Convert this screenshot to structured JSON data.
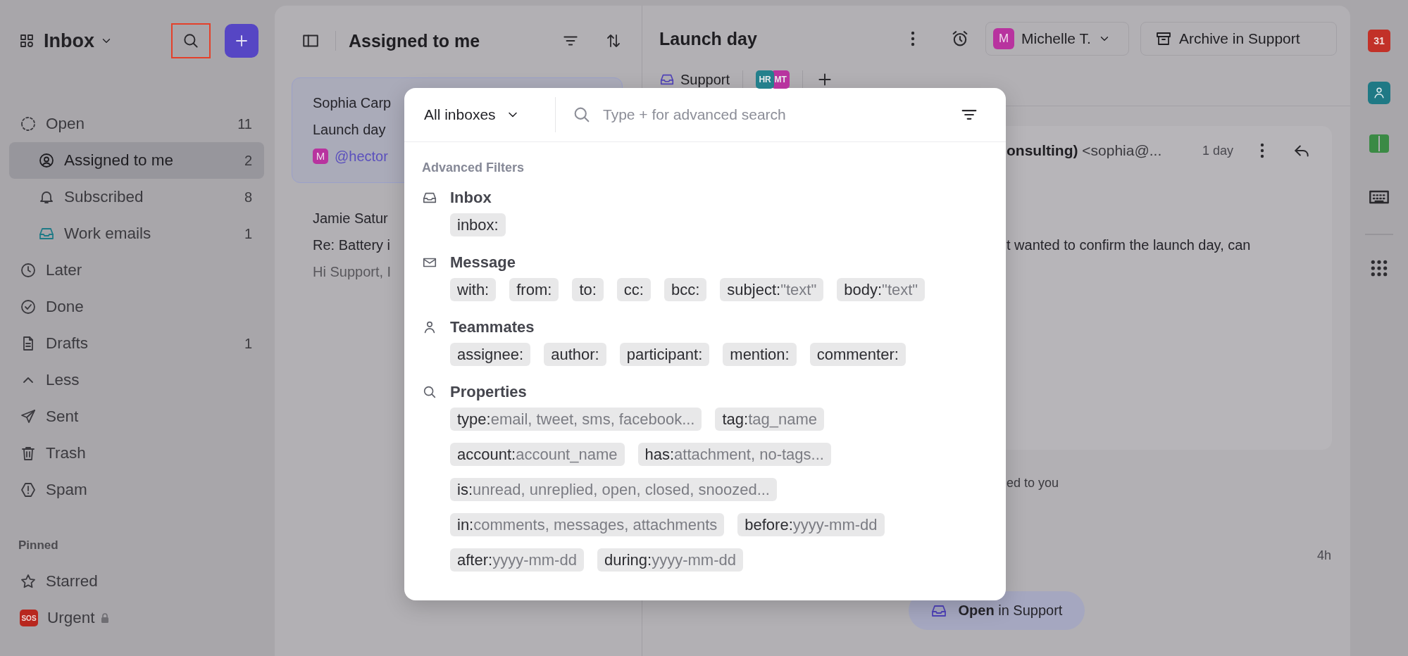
{
  "sidebar": {
    "title": "Inbox",
    "search_button": {
      "highlighted": true
    },
    "items": [
      {
        "label": "Open",
        "count": "11",
        "selected": false,
        "children": [
          {
            "label": "Assigned to me",
            "count": "2",
            "selected": true
          },
          {
            "label": "Subscribed",
            "count": "8",
            "selected": false
          },
          {
            "label": "Work emails",
            "count": "1",
            "selected": false
          }
        ]
      },
      {
        "label": "Later",
        "selected": false
      },
      {
        "label": "Done",
        "selected": false
      },
      {
        "label": "Drafts",
        "count": "1",
        "selected": false
      },
      {
        "label": "Less",
        "selected": false
      },
      {
        "label": "Sent",
        "selected": false
      },
      {
        "label": "Trash",
        "selected": false
      },
      {
        "label": "Spam",
        "selected": false
      }
    ],
    "pinned": {
      "title": "Pinned",
      "items": [
        {
          "label": "Starred",
          "locked": false
        },
        {
          "label": "Urgent",
          "badge": "SOS",
          "locked": true
        }
      ]
    }
  },
  "list": {
    "title": "Assigned to me",
    "conversations": [
      {
        "sender": "Sophia Carp",
        "subject": "Launch day",
        "avatar": "M",
        "mention": "@hector",
        "selected": true
      },
      {
        "sender": "Jamie Satur",
        "subject": "Re: Battery i",
        "preview": "Hi Support, I",
        "selected": false
      }
    ]
  },
  "conversation": {
    "title": "Launch day",
    "assignee": {
      "initial": "M",
      "name": "Michelle T."
    },
    "archive_button": "Archive in Support",
    "inbox_tag": "Support",
    "participants": [
      {
        "initials": "HR",
        "color": "#24808c"
      },
      {
        "initials": "MT",
        "color": "#b8339f"
      }
    ],
    "message": {
      "sender": "**onsulting)** <sophia@...",
      "time": "1 day",
      "body": "t wanted to confirm the launch day, can"
    },
    "activity": "ed to you",
    "activity_time": "4h",
    "open_button": "**Open** in Support"
  },
  "rail": [
    {
      "kind": "calendar",
      "label": "31"
    },
    {
      "kind": "contacts"
    },
    {
      "kind": "book"
    },
    {
      "kind": "keyboard"
    },
    {
      "kind": "apps"
    }
  ],
  "search_popup": {
    "scope": "All inboxes",
    "placeholder": "Type + for advanced search",
    "heading": "Advanced Filters",
    "sections": [
      {
        "title": "Inbox",
        "filters": [
          {
            "key": "inbox:"
          }
        ]
      },
      {
        "title": "Message",
        "filters": [
          {
            "key": "with:"
          },
          {
            "key": "from:"
          },
          {
            "key": "to:"
          },
          {
            "key": "cc:"
          },
          {
            "key": "bcc:"
          },
          {
            "key": "subject:",
            "value": "\"text\""
          },
          {
            "key": "body:",
            "value": "\"text\""
          }
        ]
      },
      {
        "title": "Teammates",
        "filters": [
          {
            "key": "assignee:"
          },
          {
            "key": "author:"
          },
          {
            "key": "participant:"
          },
          {
            "key": "mention:"
          },
          {
            "key": "commenter:"
          }
        ]
      },
      {
        "title": "Properties",
        "filters": [
          {
            "key": "type:",
            "value": "email, tweet, sms, facebook..."
          },
          {
            "key": "tag:",
            "value": "tag_name"
          },
          {
            "key": "account:",
            "value": "account_name"
          },
          {
            "key": "has:",
            "value": "attachment, no-tags..."
          },
          {
            "key": "is:",
            "value": "unread, unreplied, open, closed, snoozed..."
          },
          {
            "key": "in:",
            "value": "comments, messages, attachments"
          },
          {
            "key": "before:",
            "value": "yyyy-mm-dd"
          },
          {
            "key": "after:",
            "value": "yyyy-mm-dd"
          },
          {
            "key": "during:",
            "value": "yyyy-mm-dd"
          }
        ]
      }
    ]
  }
}
